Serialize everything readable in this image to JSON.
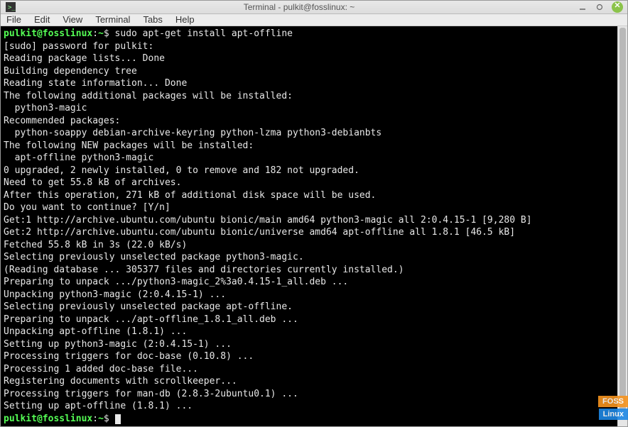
{
  "window": {
    "title": "Terminal - pulkit@fosslinux: ~"
  },
  "menu": {
    "file": "File",
    "edit": "Edit",
    "view": "View",
    "terminal": "Terminal",
    "tabs": "Tabs",
    "help": "Help"
  },
  "prompt": {
    "user_host": "pulkit@fosslinux",
    "path": "~",
    "sep1": ":",
    "sep2": "$ "
  },
  "command": "sudo apt-get install apt-offline",
  "output": [
    "[sudo] password for pulkit: ",
    "Reading package lists... Done",
    "Building dependency tree       ",
    "Reading state information... Done",
    "The following additional packages will be installed:",
    "  python3-magic",
    "Recommended packages:",
    "  python-soappy debian-archive-keyring python-lzma python3-debianbts",
    "The following NEW packages will be installed:",
    "  apt-offline python3-magic",
    "0 upgraded, 2 newly installed, 0 to remove and 182 not upgraded.",
    "Need to get 55.8 kB of archives.",
    "After this operation, 271 kB of additional disk space will be used.",
    "Do you want to continue? [Y/n] ",
    "Get:1 http://archive.ubuntu.com/ubuntu bionic/main amd64 python3-magic all 2:0.4.15-1 [9,280 B]",
    "Get:2 http://archive.ubuntu.com/ubuntu bionic/universe amd64 apt-offline all 1.8.1 [46.5 kB]",
    "Fetched 55.8 kB in 3s (22.0 kB/s)",
    "Selecting previously unselected package python3-magic.",
    "(Reading database ... 305377 files and directories currently installed.)",
    "Preparing to unpack .../python3-magic_2%3a0.4.15-1_all.deb ...",
    "Unpacking python3-magic (2:0.4.15-1) ...",
    "Selecting previously unselected package apt-offline.",
    "Preparing to unpack .../apt-offline_1.8.1_all.deb ...",
    "Unpacking apt-offline (1.8.1) ...",
    "Setting up python3-magic (2:0.4.15-1) ...",
    "Processing triggers for doc-base (0.10.8) ...",
    "Processing 1 added doc-base file...",
    "Registering documents with scrollkeeper...",
    "Processing triggers for man-db (2.8.3-2ubuntu0.1) ...",
    "Setting up apt-offline (1.8.1) ..."
  ],
  "watermark": {
    "foss": "FOSS",
    "linux": "Linux"
  }
}
